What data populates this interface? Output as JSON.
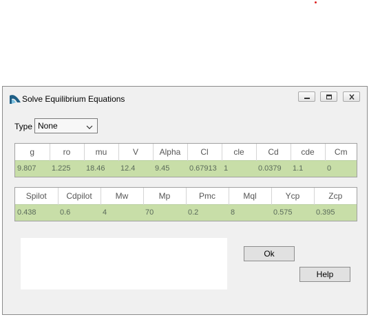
{
  "window": {
    "title": "Solve Equilibrium Equations"
  },
  "type_field": {
    "label": "Type",
    "selected": "None"
  },
  "grid1": {
    "headers": [
      "g",
      "ro",
      "mu",
      "V",
      "Alpha",
      "Cl",
      "cle",
      "Cd",
      "cde",
      "Cm"
    ],
    "values": [
      "9.807",
      "1.225",
      "18.46",
      "12.4",
      "9.45",
      "0.67913",
      "1",
      "0.0379",
      "1.1",
      "0"
    ]
  },
  "grid2": {
    "headers": [
      "Spilot",
      "Cdpilot",
      "Mw",
      "Mp",
      "Pmc",
      "Mql",
      "Ycp",
      "Zcp"
    ],
    "values": [
      "0.438",
      "0.6",
      "4",
      "70",
      "0.2",
      "8",
      "0.575",
      "0.395"
    ]
  },
  "buttons": {
    "ok": "Ok",
    "help": "Help"
  },
  "colors": {
    "row_bg": "#c8dea8",
    "window_bg": "#f0f0f0",
    "marker_dot": "#d22222"
  },
  "icons": {
    "app": "app-logo-icon",
    "minimize": "minimize-icon",
    "maximize": "maximize-icon",
    "close": "close-icon",
    "dropdown": "chevron-down-icon"
  }
}
